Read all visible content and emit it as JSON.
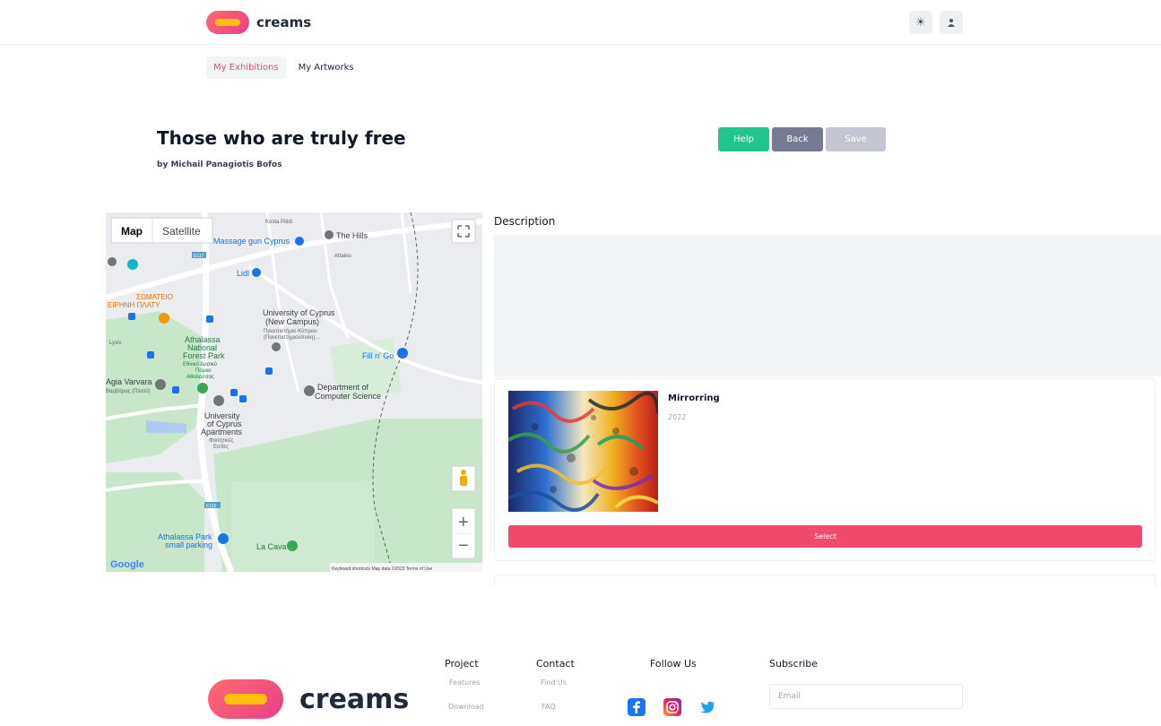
{
  "brand": {
    "name": "creams"
  },
  "header": {
    "theme_icon": "sun-icon",
    "user_icon": "user-icon"
  },
  "tabs": [
    {
      "label": "My Exhibitions",
      "active": true
    },
    {
      "label": "My Artworks",
      "active": false
    }
  ],
  "exhibition": {
    "title": "Those who are truly free",
    "byline": "by Michail Panagiotis Bofos"
  },
  "actions": {
    "help": "Help",
    "back": "Back",
    "save": "Save"
  },
  "map": {
    "type_map": "Map",
    "type_satellite": "Satellite",
    "labels": {
      "massage": "Massage gun Cyprus",
      "hills": "The Hills",
      "lidl": "Lidl",
      "somateio": "ΣΩΜΑΤΕΙΟ",
      "eirini": "ΕΙΡΗΝΗ ΠΛΑΤΥ",
      "univ1": "University of Cyprus",
      "univ2": "(New Campus)",
      "univ3": "Πανεπιστήμιο Κύπρου",
      "univ4": "(Πανεπιστημιούπολη)...",
      "park1": "Athalassa",
      "park2": "National",
      "park3": "Forest Park",
      "park4": "Εθνικό Δασικό",
      "park5": "Πάρκο",
      "park6": "Αθαλάσσας",
      "fill": "Fill n' Go",
      "agia1": "Agia Varvara",
      "agia2": "Βαρβάρας (Πλατύ)",
      "dept1": "Department of",
      "dept2": "Computer Science",
      "apt1": "University",
      "apt2": "of Cyprus",
      "apt3": "Apartments",
      "apt4": "Φοιτητικές",
      "apt5": "Εστίες",
      "parking1": "Athalassa Park",
      "parking2": "small parking",
      "lacava": "La Cava",
      "kosta": "Kosta Pitidi",
      "attalou": "Attalou",
      "e117": "E117",
      "e115": "E115",
      "lysis": "Lysis"
    },
    "zoom_in": "+",
    "zoom_out": "−",
    "google": "Google",
    "attribution": "Keyboard shortcuts   Map data ©2023   Terms of Use"
  },
  "description": {
    "label": "Description",
    "text": ""
  },
  "artwork": {
    "title": "Mirrorring",
    "year": "2022",
    "select": "Select"
  },
  "footer": {
    "brand": "creams",
    "project": {
      "title": "Project",
      "links": [
        "Features",
        "Download"
      ]
    },
    "contact": {
      "title": "Contact",
      "links": [
        "Find Us",
        "FAQ"
      ]
    },
    "follow": {
      "title": "Follow Us",
      "icons": [
        "facebook-icon",
        "instagram-icon",
        "twitter-icon"
      ]
    },
    "subscribe": {
      "title": "Subscribe",
      "placeholder": "Email"
    }
  },
  "colors": {
    "accent": "#ef4a6b",
    "help": "#22c58b",
    "back": "#767b91",
    "save": "#c3c6d0"
  }
}
